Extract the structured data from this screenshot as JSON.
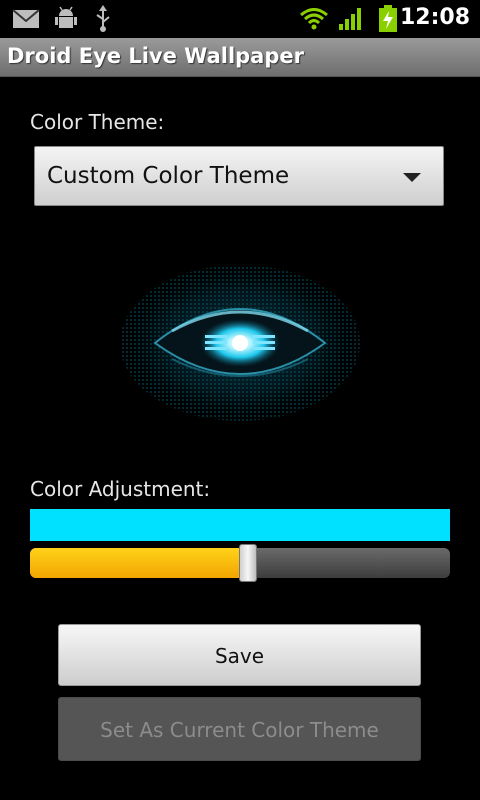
{
  "status_bar": {
    "time": "12:08",
    "icons": [
      "gmail-icon",
      "android-debug-icon",
      "usb-icon",
      "wifi-icon",
      "signal-icon",
      "battery-charging-icon"
    ]
  },
  "title_bar": {
    "title": "Droid Eye Live Wallpaper"
  },
  "color_theme": {
    "label": "Color Theme:",
    "selected": "Custom Color Theme"
  },
  "color_adjustment": {
    "label": "Color Adjustment:",
    "swatch_color": "#00e0ff",
    "slider_fraction": 0.52
  },
  "actions": {
    "save_label": "Save",
    "set_label": "Set As Current Color Theme"
  },
  "colors": {
    "accent": "#00e0ff",
    "slider_fill": "#ffc107"
  }
}
